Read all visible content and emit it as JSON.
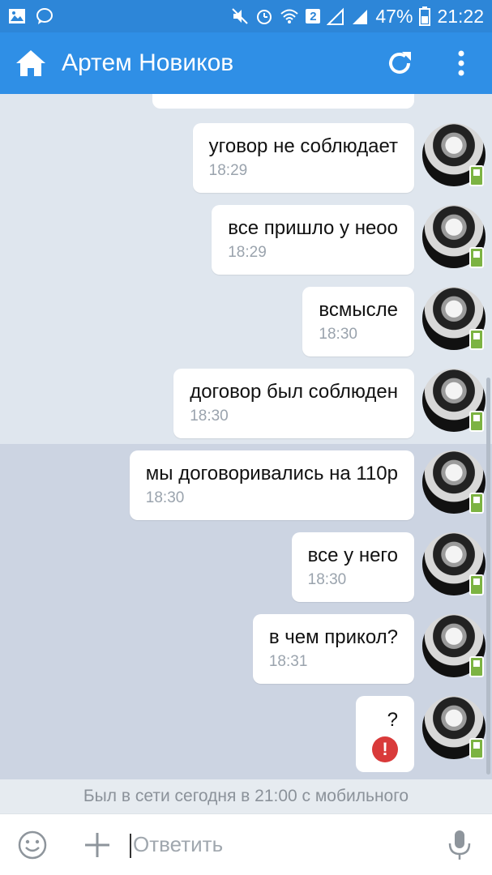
{
  "status_bar": {
    "battery": "47%",
    "time": "21:22",
    "sim_badge": "2"
  },
  "header": {
    "title": "Артем Новиков"
  },
  "messages": [
    {
      "text": "уговор не соблюдает",
      "time": "18:29"
    },
    {
      "text": "все пришло у неоо",
      "time": "18:29"
    },
    {
      "text": "всмысле",
      "time": "18:30"
    },
    {
      "text": "договор был соблюден",
      "time": "18:30"
    },
    {
      "text": "мы договоривались на 110р",
      "time": "18:30"
    },
    {
      "text": "все у него",
      "time": "18:30"
    },
    {
      "text": "в чем прикол?",
      "time": "18:31"
    }
  ],
  "failed_message": {
    "text": "?",
    "error_mark": "!"
  },
  "last_seen": "Был в сети сегодня в 21:00 с мобильного",
  "composer": {
    "placeholder": "Ответить"
  },
  "colors": {
    "status_bar": "#2d86d8",
    "app_bar": "#2f8fe6",
    "chat_bg": "#dfe6ee",
    "unread_bg": "#ccd4e2",
    "error": "#d93a3a",
    "mobile_badge": "#7cb342"
  }
}
